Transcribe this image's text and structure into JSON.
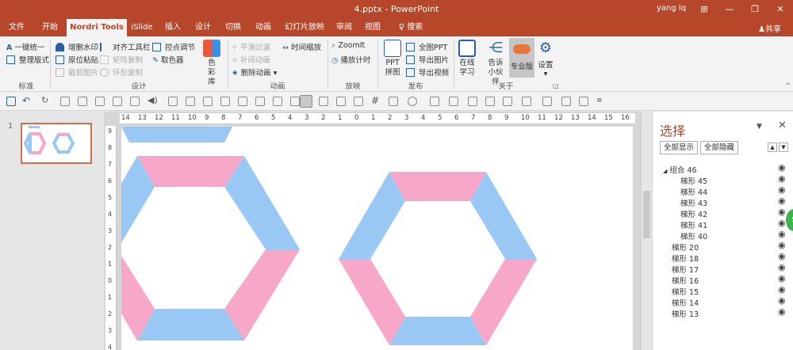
{
  "window": {
    "title": "4.pptx - PowerPoint",
    "user": "yang lq",
    "controls": [
      "⊞",
      "—",
      "❐",
      "✕"
    ],
    "share_label": "共享"
  },
  "tabs": [
    {
      "label": "文件"
    },
    {
      "label": "开始"
    },
    {
      "label": "Nordri Tools",
      "active": true
    },
    {
      "label": "iSlide"
    },
    {
      "label": "插入"
    },
    {
      "label": "设计"
    },
    {
      "label": "切换"
    },
    {
      "label": "动画"
    },
    {
      "label": "幻灯片放映"
    },
    {
      "label": "审阅"
    },
    {
      "label": "视图"
    },
    {
      "label": "搜索"
    }
  ],
  "ribbon": {
    "groups": {
      "standard": {
        "label": "标准",
        "items": [
          "一键统一",
          "整理版式"
        ]
      },
      "design": {
        "label": "设计",
        "items": [
          "增删水印",
          "原位粘贴",
          "截剪图片",
          "对齐工具栏",
          "矩阵复制",
          "环形复制",
          "控点调节",
          "取色器"
        ],
        "big": "色彩库"
      },
      "animation": {
        "label": "动画",
        "items": [
          "平滑过渡",
          "补间动画",
          "删除动画",
          "时间缩放"
        ]
      },
      "play": {
        "label": "放映",
        "items": [
          "ZoomIt",
          "播放计时"
        ]
      },
      "publish": {
        "label": "发布",
        "big": "PPT拼图",
        "items": [
          "全图PPT",
          "导出图片",
          "导出视频"
        ]
      },
      "about": {
        "label": "关于",
        "big": [
          "在线学习",
          "告诉小伙伴",
          "专业版",
          "设置"
        ]
      }
    }
  },
  "slides": {
    "current": "1"
  },
  "ruler": {
    "h_ticks": [
      "14",
      "13",
      "12",
      "11",
      "10",
      "9",
      "8",
      "7",
      "6",
      "5",
      "4",
      "3",
      "2",
      "1",
      "0",
      "1",
      "2",
      "3",
      "4",
      "5",
      "6",
      "7",
      "8",
      "9",
      "10",
      "11",
      "12",
      "13",
      "14",
      "15",
      "16"
    ],
    "v_ticks": [
      "9",
      "8",
      "7",
      "6",
      "5",
      "4",
      "3",
      "2",
      "1",
      "0",
      "1",
      "2",
      "3",
      "4"
    ]
  },
  "colors": {
    "accent": "#b7472a",
    "pink": "#f7a8c8",
    "blue": "#99c8f5"
  },
  "selection_pane": {
    "title": "选择",
    "show_all": "全部显示",
    "hide_all": "全部隐藏",
    "group": "组合 46",
    "children": [
      "梯形 45",
      "梯形 44",
      "梯形 43",
      "梯形 42",
      "梯形 41",
      "梯形 40"
    ],
    "items": [
      "梯形 20",
      "梯形 18",
      "梯形 17",
      "梯形 16",
      "梯形 15",
      "梯形 14",
      "梯形 13"
    ],
    "badge": "5"
  }
}
